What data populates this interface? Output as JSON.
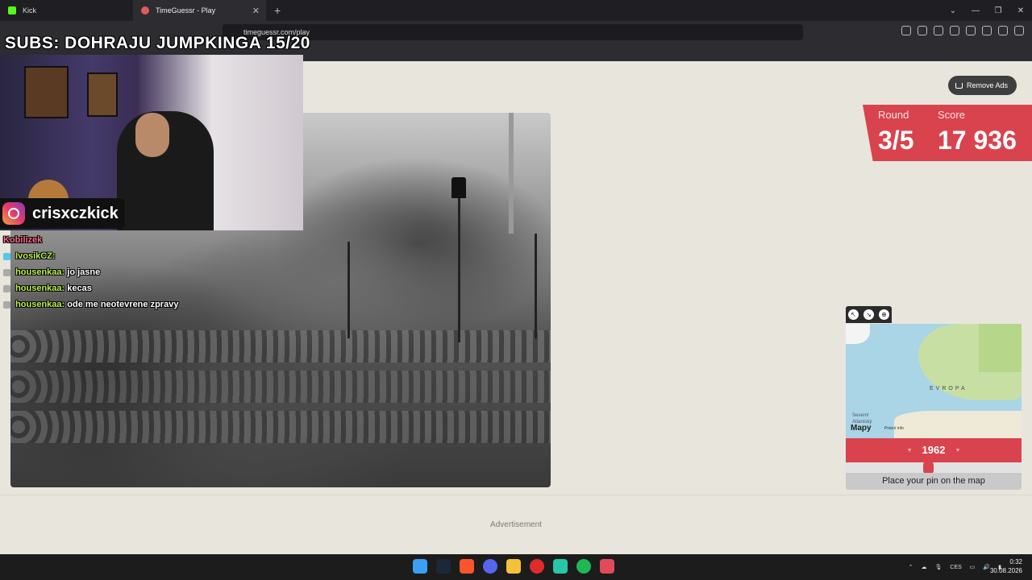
{
  "browser": {
    "tabs": [
      {
        "label": "Kick",
        "active": false
      },
      {
        "label": "TimeGuessr - Play",
        "active": true
      }
    ],
    "url": "timeguessr.com/play"
  },
  "overlay": {
    "subs_banner": "SUBS: DOHRAJU JUMPKINGA 15/20",
    "instagram_handle": "crisxczkick",
    "chat": [
      {
        "user": "Kobilizek",
        "message": ""
      },
      {
        "user": "IvosikCZ:",
        "message": ""
      },
      {
        "user": "housenkaa:",
        "message": "jo jasne"
      },
      {
        "user": "housenkaa:",
        "message": "kecas"
      },
      {
        "user": "housenkaa:",
        "message": "ode me neotevrene zpravy"
      }
    ]
  },
  "game": {
    "remove_ads_label": "Remove Ads",
    "round_label": "Round",
    "round_value": "3/5",
    "score_label": "Score",
    "score_value": "17 936",
    "map": {
      "region_label": "EVROPA",
      "ocean_label_line1": "Severní",
      "ocean_label_line2": "Atlantský",
      "brand": "Mapy",
      "legal": "Právní info"
    },
    "year": "1962",
    "year_slider_fraction": 0.47,
    "pin_button_label": "Place your pin on the map",
    "advertisement_label": "Advertisement"
  },
  "taskbar": {
    "language": "CES",
    "time": "0:32",
    "date": "30.08.2026"
  },
  "colors": {
    "accent_red": "#d9434e",
    "page_bg": "#e8e6dc",
    "browser_dark": "#2c2c31"
  }
}
